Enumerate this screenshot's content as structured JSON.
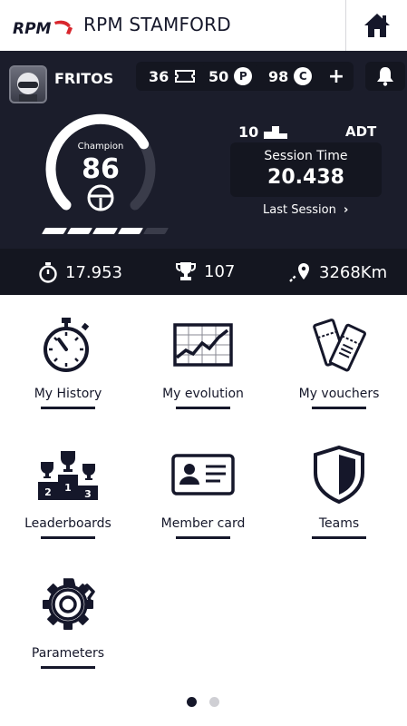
{
  "header": {
    "brand": "RPM STAMFORD",
    "logo_text": "RPM",
    "home_icon": "home-icon"
  },
  "user": {
    "name": "FRITOS",
    "tickets": "36",
    "points": "50",
    "credits": "98",
    "points_symbol": "P",
    "credits_symbol": "C",
    "plus": "+"
  },
  "gauge": {
    "label": "Champion",
    "value": "86",
    "progress_fraction": 0.72,
    "level_bars_filled": 4,
    "level_bars_total": 5
  },
  "session": {
    "grid_position": "10",
    "track": "ADT",
    "label": "Session Time",
    "value": "20.438",
    "last_session": "Last Session",
    "chevron": "›"
  },
  "stats": {
    "best_lap": "17.953",
    "trophies": "107",
    "distance": "3268Km"
  },
  "menu": [
    {
      "label": "My History",
      "icon": "stopwatch-icon"
    },
    {
      "label": "My evolution",
      "icon": "chart-icon"
    },
    {
      "label": "My vouchers",
      "icon": "vouchers-icon"
    },
    {
      "label": "Leaderboards",
      "icon": "podium-icon"
    },
    {
      "label": "Member card",
      "icon": "member-card-icon"
    },
    {
      "label": "Teams",
      "icon": "shield-icon"
    },
    {
      "label": "Parameters",
      "icon": "gear-icon"
    }
  ],
  "pagination": {
    "current": 1,
    "total": 2
  },
  "colors": {
    "panel": "#1b1d2b",
    "accent_red": "#d8262d",
    "text_dark": "#15172a"
  }
}
